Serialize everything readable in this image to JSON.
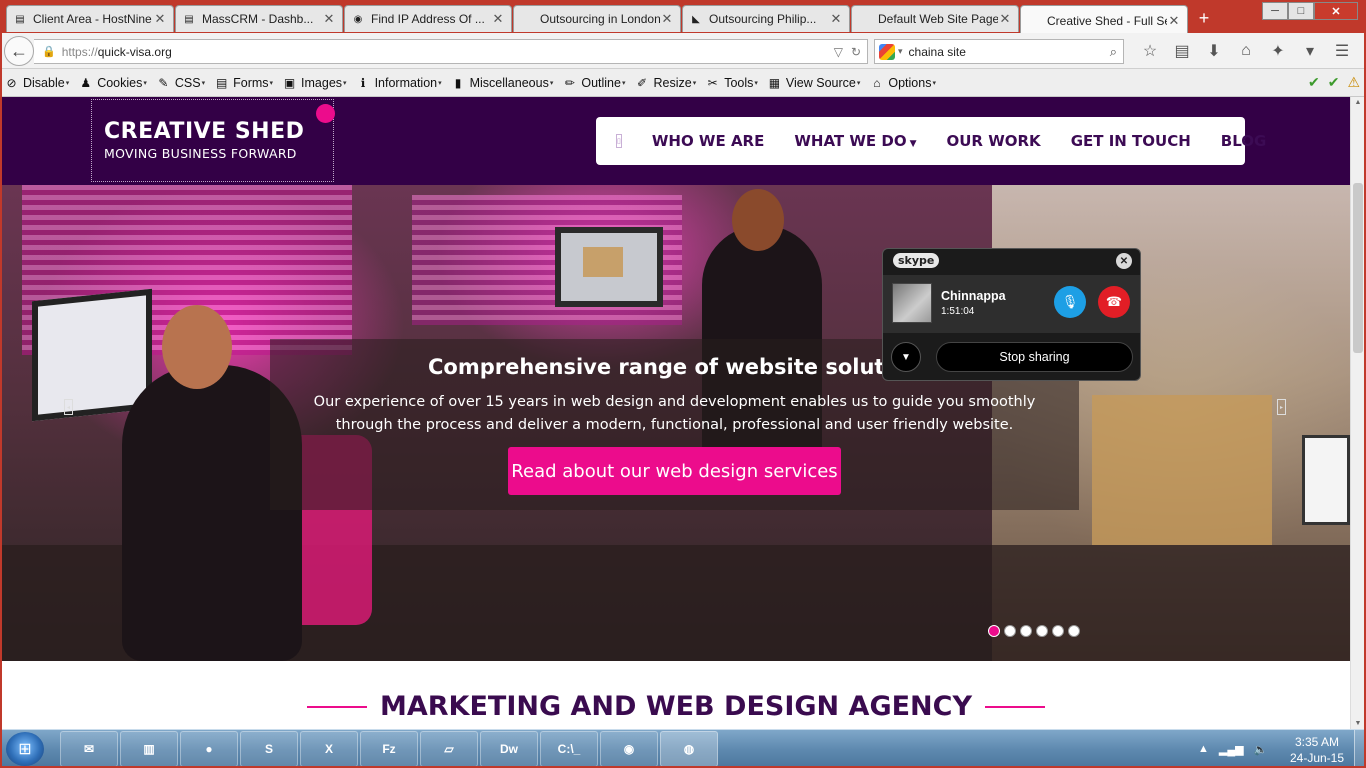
{
  "browser": {
    "tabs": [
      {
        "title": "Client Area - HostNine ...",
        "icon": "document-icon",
        "active": false
      },
      {
        "title": "MassCRM - Dashb...",
        "icon": "crm-icon",
        "active": false
      },
      {
        "title": "Find IP Address Of ...",
        "icon": "globe-icon",
        "active": false
      },
      {
        "title": "Outsourcing in London",
        "icon": "",
        "active": false
      },
      {
        "title": "Outsourcing Philip...",
        "icon": "k-icon",
        "active": false
      },
      {
        "title": "Default Web Site Page",
        "icon": "",
        "active": false
      },
      {
        "title": "Creative Shed - Full Ser...",
        "icon": "",
        "active": true
      }
    ],
    "new_tab": "+",
    "url_proto": "https://",
    "url_host": "quick-visa.org",
    "search_query": "chaina site",
    "window_buttons": {
      "minimize": "─",
      "maximize": "□",
      "close": "✕"
    }
  },
  "devtoolbar": {
    "items": [
      {
        "label": "Disable",
        "icon": "disable-icon",
        "glyph": "⊘"
      },
      {
        "label": "Cookies",
        "icon": "cookies-icon",
        "glyph": "♟"
      },
      {
        "label": "CSS",
        "icon": "css-icon",
        "glyph": "✎"
      },
      {
        "label": "Forms",
        "icon": "forms-icon",
        "glyph": "▤"
      },
      {
        "label": "Images",
        "icon": "images-icon",
        "glyph": "▣"
      },
      {
        "label": "Information",
        "icon": "information-icon",
        "glyph": "ℹ"
      },
      {
        "label": "Miscellaneous",
        "icon": "miscellaneous-icon",
        "glyph": "▮"
      },
      {
        "label": "Outline",
        "icon": "outline-icon",
        "glyph": "✏"
      },
      {
        "label": "Resize",
        "icon": "resize-icon",
        "glyph": "✐"
      },
      {
        "label": "Tools",
        "icon": "tools-icon",
        "glyph": "✂"
      },
      {
        "label": "View Source",
        "icon": "view-source-icon",
        "glyph": "▦"
      },
      {
        "label": "Options",
        "icon": "options-icon",
        "glyph": "⌂"
      }
    ]
  },
  "site": {
    "logo_line1": "CREATIVE SHED",
    "logo_line2": "MOVING BUSINESS FORWARD",
    "nav": [
      "WHO WE ARE",
      "WHAT WE DO",
      "OUR WORK",
      "GET IN TOUCH",
      "BLOG"
    ],
    "hero_headline": "Comprehensive range of website solution",
    "hero_desc": "Our experience of over 15 years in web design and development enables us to guide you smoothly through the process and deliver a modern, functional, professional and user friendly website.",
    "hero_cta": "Read about our web design services",
    "slider_dots": 6,
    "slider_active": 0,
    "agency_heading": "MARKETING AND WEB DESIGN AGENCY",
    "colors": {
      "brand_purple": "#330046",
      "brand_pink": "#ec0c8c"
    }
  },
  "skype": {
    "logo": "skype",
    "contact_name": "Chinnappa",
    "call_time": "1:51:04",
    "stop_sharing": "Stop sharing"
  },
  "taskbar": {
    "apps": [
      {
        "name": "outlook",
        "glyph": "✉"
      },
      {
        "name": "explorer",
        "glyph": "▥"
      },
      {
        "name": "chrome",
        "glyph": "●"
      },
      {
        "name": "skype",
        "glyph": "S"
      },
      {
        "name": "excel",
        "glyph": "X"
      },
      {
        "name": "filezilla",
        "glyph": "Fz"
      },
      {
        "name": "notepad",
        "glyph": "▱"
      },
      {
        "name": "dreamweaver",
        "glyph": "Dw"
      },
      {
        "name": "cmd",
        "glyph": "C:\\_"
      },
      {
        "name": "webcam",
        "glyph": "◉"
      },
      {
        "name": "firefox",
        "glyph": "◍"
      }
    ],
    "time": "3:35 AM",
    "date": "24-Jun-15"
  }
}
